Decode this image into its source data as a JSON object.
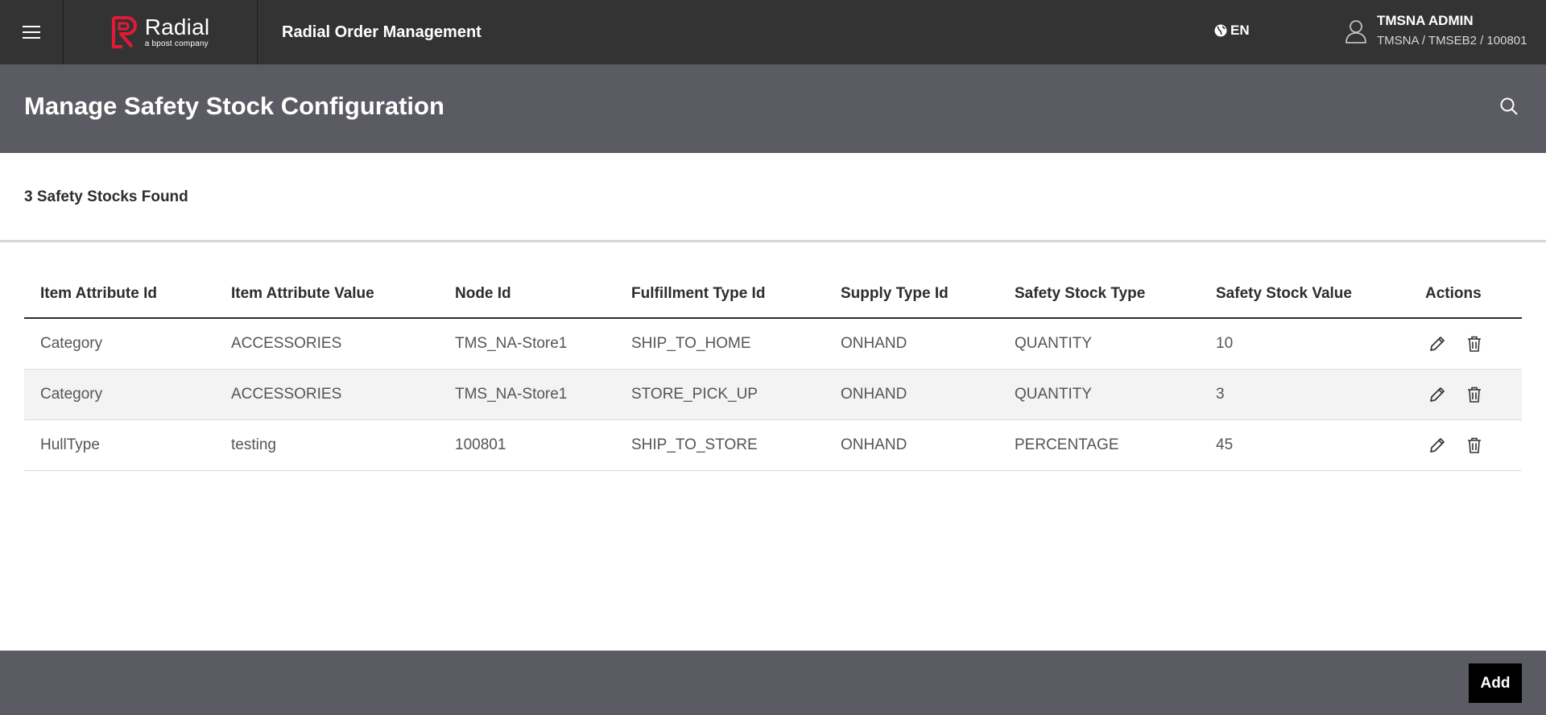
{
  "header": {
    "logo_name": "Radial",
    "logo_tagline": "a bpost company",
    "app_title": "Radial Order Management",
    "language": "EN",
    "user_name": "TMSNA ADMIN",
    "user_org": "TMSNA / TMSEB2 / 100801",
    "brand_color": "#e31937"
  },
  "page": {
    "title": "Manage Safety Stock Configuration",
    "results_count": "3 Safety Stocks Found"
  },
  "table": {
    "columns": [
      "Item Attribute Id",
      "Item Attribute Value",
      "Node Id",
      "Fulfillment Type Id",
      "Supply Type Id",
      "Safety Stock Type",
      "Safety Stock Value",
      "Actions"
    ],
    "rows": [
      [
        "Category",
        "ACCESSORIES",
        "TMS_NA-Store1",
        "SHIP_TO_HOME",
        "ONHAND",
        "QUANTITY",
        "10"
      ],
      [
        "Category",
        "ACCESSORIES",
        "TMS_NA-Store1",
        "STORE_PICK_UP",
        "ONHAND",
        "QUANTITY",
        "3"
      ],
      [
        "HullType",
        "testing",
        "100801",
        "SHIP_TO_STORE",
        "ONHAND",
        "PERCENTAGE",
        "45"
      ]
    ]
  },
  "footer": {
    "add_label": "Add"
  },
  "icons": {
    "menu": "hamburger-icon",
    "language": "globe-icon",
    "user": "user-icon",
    "search": "search-icon",
    "edit": "pencil-icon",
    "delete": "trash-icon"
  }
}
